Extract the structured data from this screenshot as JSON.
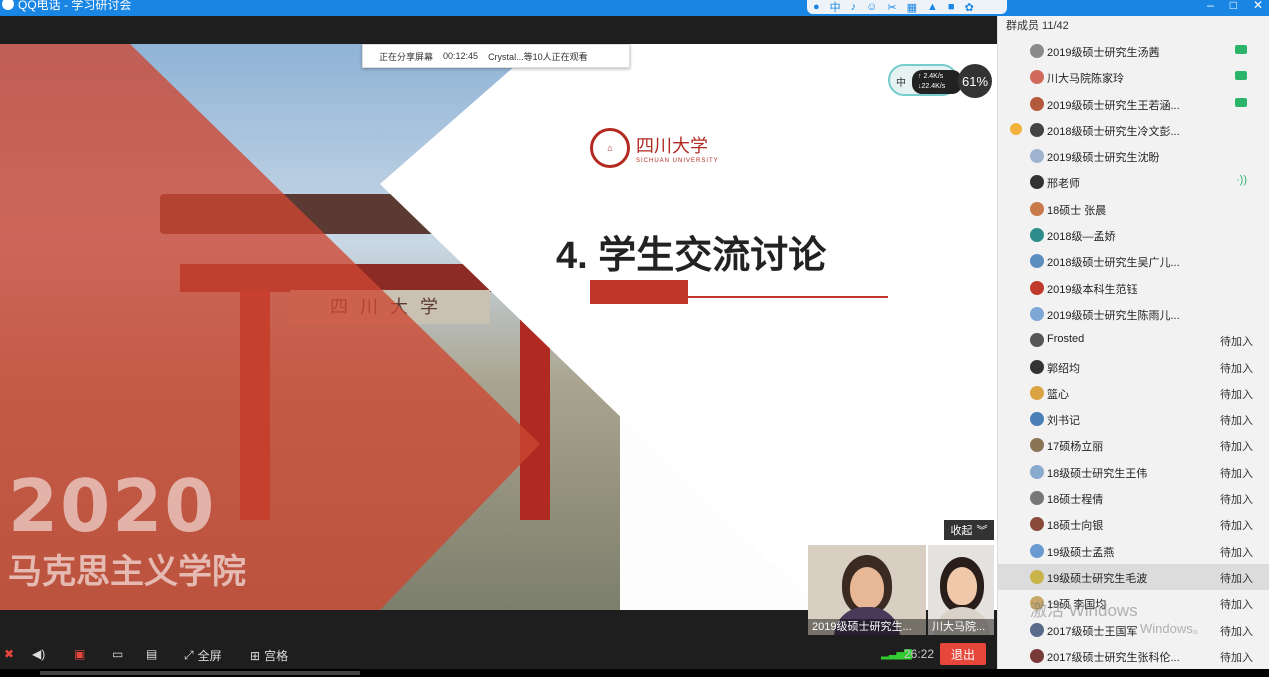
{
  "window": {
    "title": "QQ电话 - 学习研讨会"
  },
  "share_banner": {
    "status": "正在分享屏幕",
    "elapsed": "00:12:45",
    "viewers": "Crystal...等10人正在观看"
  },
  "net_widget": {
    "lang": "中",
    "up": "↑ 2.4K/s",
    "down": "↓22.4K/s",
    "percent": "61%"
  },
  "slide": {
    "year": "2020",
    "school": "马克思主义学院",
    "gate_sign": "四川大学",
    "logo_cn": "四川大学",
    "logo_en": "SICHUAN UNIVERSITY",
    "title": "4.   学生交流讨论"
  },
  "collapse_label": "收起",
  "videos": [
    {
      "caption": "2019级硕士研究生..."
    },
    {
      "caption": "川大马院..."
    }
  ],
  "toolbar": {
    "fullscreen": "全屏",
    "grid": "宫格",
    "timer": "26:22",
    "exit": "退出"
  },
  "members": {
    "header": "群成员 11/42",
    "items": [
      {
        "name": "2019级硕士研究生汤茜",
        "status": "",
        "icon": "screen-share",
        "color": "#8a8a8a"
      },
      {
        "name": "川大马院陈家玲",
        "status": "",
        "icon": "video",
        "color": "#d06a5a"
      },
      {
        "name": "2019级硕士研究生王若涵...",
        "status": "",
        "icon": "video",
        "color": "#b35a3a"
      },
      {
        "name": "2018级硕士研究生冷文彭...",
        "status": "",
        "icon": "host",
        "color": "#444444"
      },
      {
        "name": "2019级硕士研究生沈盼",
        "status": "",
        "icon": "",
        "color": "#9fb3cf"
      },
      {
        "name": "邢老师",
        "status": "",
        "icon": "speaking",
        "color": "#333333"
      },
      {
        "name": "18硕士 张晨",
        "status": "",
        "icon": "",
        "color": "#c97a4a"
      },
      {
        "name": "2018级—孟娇",
        "status": "",
        "icon": "",
        "color": "#2f8c8c"
      },
      {
        "name": "2018级硕士研究生吴广儿...",
        "status": "",
        "icon": "",
        "color": "#5c8fbf"
      },
      {
        "name": "2019级本科生范钰",
        "status": "",
        "icon": "",
        "color": "#c0392b"
      },
      {
        "name": "2019级硕士研究生陈雨儿...",
        "status": "",
        "icon": "",
        "color": "#7fa7d6"
      },
      {
        "name": "Frosted",
        "status": "待加入",
        "icon": "",
        "color": "#555555"
      },
      {
        "name": "郭绍均",
        "status": "待加入",
        "icon": "",
        "color": "#333333"
      },
      {
        "name": "篮心",
        "status": "待加入",
        "icon": "",
        "color": "#d9a441"
      },
      {
        "name": "刘书记",
        "status": "待加入",
        "icon": "",
        "color": "#4a7fb5"
      },
      {
        "name": "17硕杨立丽",
        "status": "待加入",
        "icon": "",
        "color": "#8b7355"
      },
      {
        "name": "18级硕士研究生王伟",
        "status": "待加入",
        "icon": "",
        "color": "#88aacc"
      },
      {
        "name": "18硕士程倩",
        "status": "待加入",
        "icon": "",
        "color": "#777777"
      },
      {
        "name": "18硕士向银",
        "status": "待加入",
        "icon": "",
        "color": "#8a4a3a"
      },
      {
        "name": "19级硕士孟燕",
        "status": "待加入",
        "icon": "",
        "color": "#6a9ad0"
      },
      {
        "name": "19级硕士研究生毛波",
        "status": "待加入",
        "icon": "",
        "color": "#c9b44a",
        "selected": true
      },
      {
        "name": "19硕 李国均",
        "status": "待加入",
        "icon": "",
        "color": "#c9a96a"
      },
      {
        "name": "2017级硕士王国军",
        "status": "待加入",
        "icon": "",
        "color": "#5a6a8a"
      },
      {
        "name": "2017级硕士研究生张科伦...",
        "status": "待加入",
        "icon": "",
        "color": "#7a3a3a"
      }
    ]
  },
  "watermark": {
    "line1": "激活 Windows",
    "line2": "Windows。"
  }
}
